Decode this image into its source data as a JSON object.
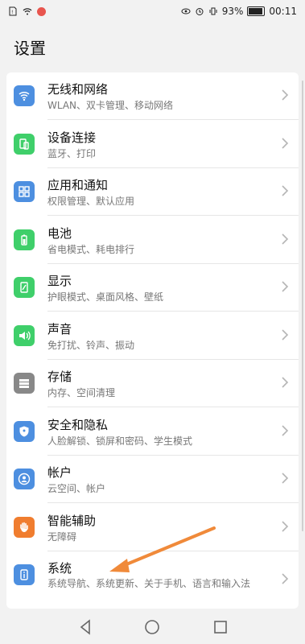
{
  "status": {
    "battery": "93%",
    "time": "00:11",
    "battery_level": 0.93
  },
  "header": {
    "title": "设置"
  },
  "items": [
    {
      "title": "无线和网络",
      "sub": "WLAN、双卡管理、移动网络",
      "icon": "wifi-icon",
      "color": "#4d8fe0"
    },
    {
      "title": "设备连接",
      "sub": "蓝牙、打印",
      "icon": "device-connect-icon",
      "color": "#3fcf6a"
    },
    {
      "title": "应用和通知",
      "sub": "权限管理、默认应用",
      "icon": "apps-grid-icon",
      "color": "#4d8fe0"
    },
    {
      "title": "电池",
      "sub": "省电模式、耗电排行",
      "icon": "battery-icon",
      "color": "#3fcf6a"
    },
    {
      "title": "显示",
      "sub": "护眼模式、桌面风格、壁纸",
      "icon": "display-icon",
      "color": "#3fcf6a"
    },
    {
      "title": "声音",
      "sub": "免打扰、铃声、振动",
      "icon": "sound-icon",
      "color": "#3fcf6a"
    },
    {
      "title": "存储",
      "sub": "内存、空间清理",
      "icon": "storage-icon",
      "color": "#888888"
    },
    {
      "title": "安全和隐私",
      "sub": "人脸解锁、锁屏和密码、学生模式",
      "icon": "shield-icon",
      "color": "#4d8fe0"
    },
    {
      "title": "帐户",
      "sub": "云空间、帐户",
      "icon": "account-icon",
      "color": "#4d8fe0"
    },
    {
      "title": "智能辅助",
      "sub": "无障碍",
      "icon": "hand-icon",
      "color": "#f07d2f"
    },
    {
      "title": "系统",
      "sub": "系统导航、系统更新、关于手机、语言和输入法",
      "icon": "system-icon",
      "color": "#4d8fe0"
    }
  ],
  "colors": {
    "annotation_arrow": "#f08a3a"
  }
}
